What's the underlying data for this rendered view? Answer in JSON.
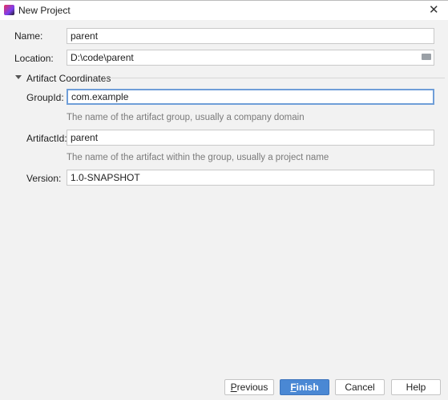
{
  "window": {
    "title": "New Project",
    "close_icon": "close-icon"
  },
  "form": {
    "name_label": "Name:",
    "name_value": "parent",
    "location_label": "Location:",
    "location_value": "D:\\code\\parent",
    "section_label": "Artifact Coordinates",
    "groupid_label": "GroupId:",
    "groupid_value": "com.example",
    "groupid_hint": "The name of the artifact group, usually a company domain",
    "artifactid_label": "ArtifactId:",
    "artifactid_value": "parent",
    "artifactid_hint": "The name of the artifact within the group, usually a project name",
    "version_label": "Version:",
    "version_value": "1.0-SNAPSHOT"
  },
  "buttons": {
    "previous_first": "P",
    "previous_rest": "revious",
    "finish_first": "F",
    "finish_rest": "inish",
    "cancel": "Cancel",
    "help": "Help"
  },
  "colors": {
    "accent": "#4a88d4",
    "focus": "#6f9ed8"
  }
}
